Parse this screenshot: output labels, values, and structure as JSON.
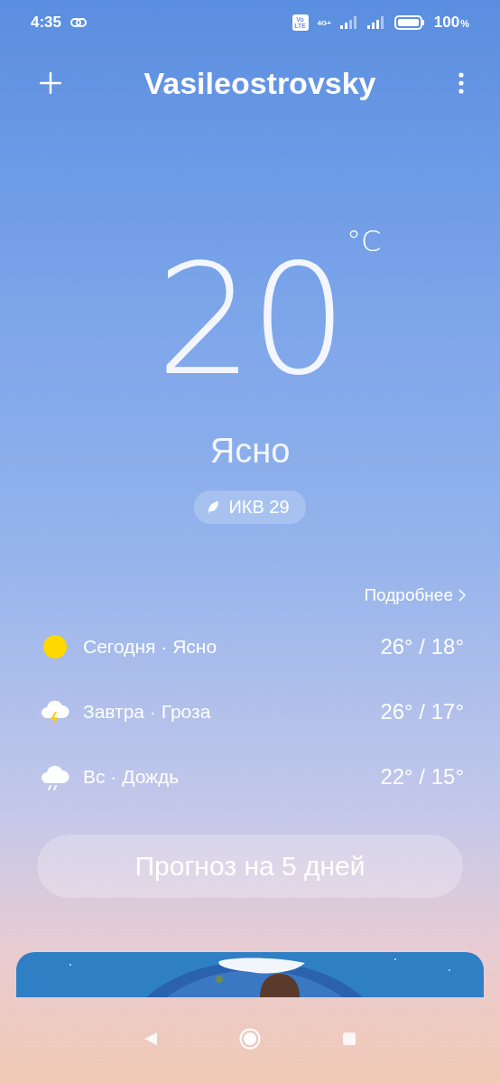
{
  "status_bar": {
    "time": "4:35",
    "volte": "Vo LTE",
    "network": "4G+",
    "battery": "100",
    "battery_unit": "%"
  },
  "header": {
    "city": "Vasileostrovsky"
  },
  "current": {
    "temperature": "20",
    "unit": "°C",
    "condition": "Ясно",
    "aqi": "ИКВ 29"
  },
  "forecast": {
    "more_link": "Подробнее",
    "days": [
      {
        "kind": "sun",
        "label": "Сегодня · Ясно",
        "temps": "26° / 18°"
      },
      {
        "kind": "storm",
        "label": "Завтра · Гроза",
        "temps": "26° / 17°"
      },
      {
        "kind": "rain",
        "label": "Вс · Дождь",
        "temps": "22° / 15°"
      }
    ],
    "button": "Прогноз на 5 дней"
  }
}
